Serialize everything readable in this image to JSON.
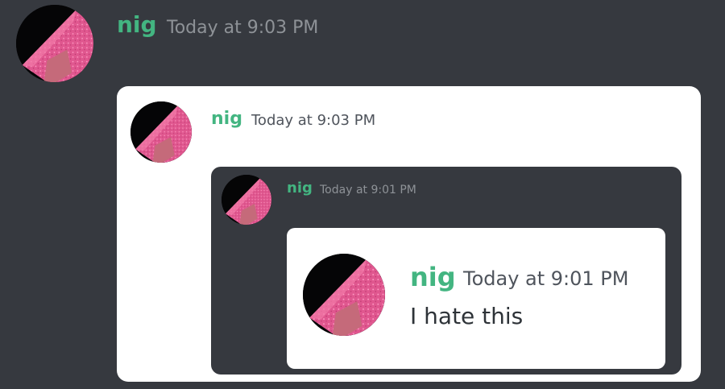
{
  "theme": {
    "background": "#36393f",
    "username_color": "#43b581",
    "white_card": "#ffffff",
    "dark_card": "#36393f",
    "avatar_accent": "#e0578f"
  },
  "messages": {
    "level1": {
      "avatar_icon": "avatar-pink-glitter",
      "username": "nig",
      "timestamp": "Today at 9:03 PM"
    },
    "level2": {
      "avatar_icon": "avatar-pink-glitter",
      "username": "nig",
      "timestamp": "Today at 9:03 PM"
    },
    "level3": {
      "avatar_icon": "avatar-pink-glitter",
      "username": "nig",
      "timestamp": "Today at 9:01 PM"
    },
    "level4": {
      "avatar_icon": "avatar-pink-glitter",
      "username": "nig",
      "timestamp": "Today at 9:01 PM",
      "text": "I hate this"
    }
  }
}
